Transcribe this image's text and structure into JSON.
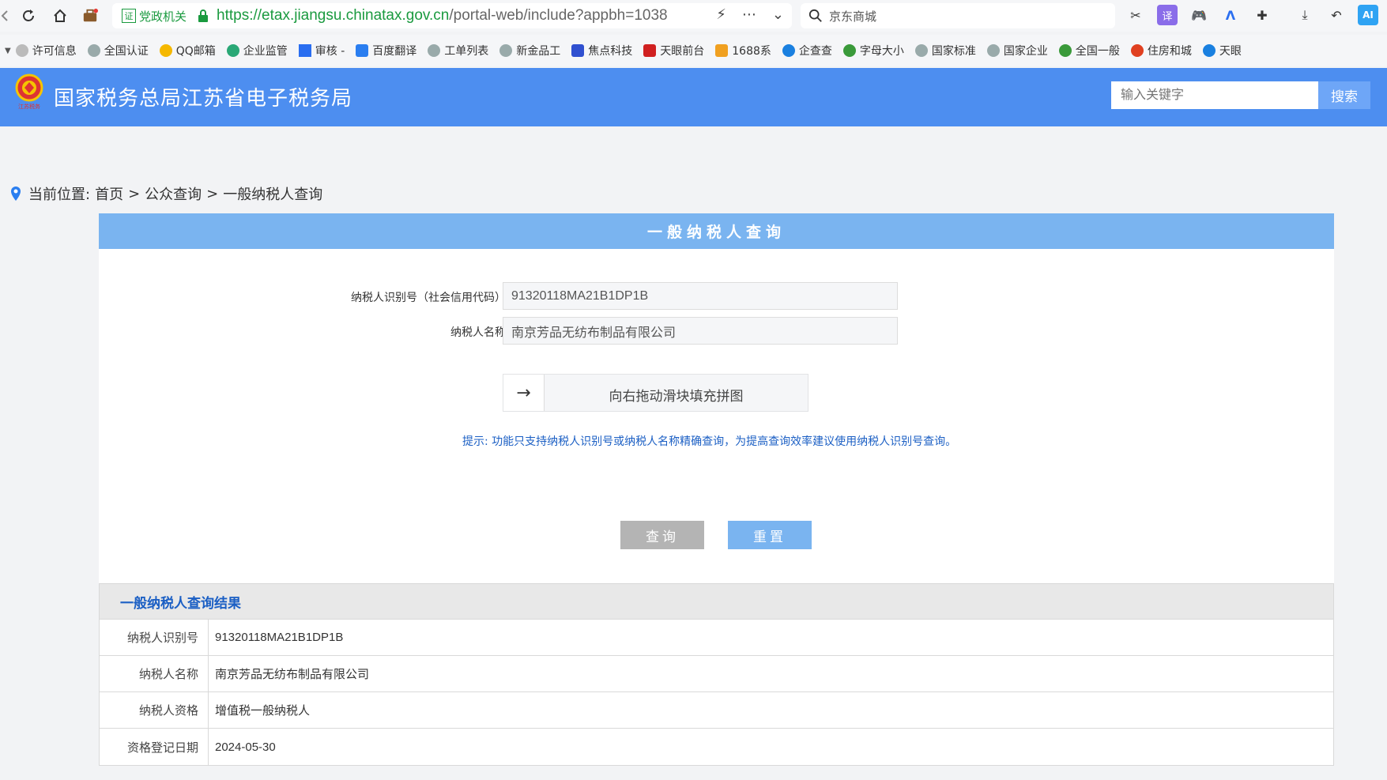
{
  "browser": {
    "gov_badge": "党政机关",
    "gov_badge_icon": "证",
    "url_host": "https://etax.jiangsu.chinatax.gov.cn",
    "url_path": "/portal-web/include?appbh=1038",
    "search_text": "京东商城",
    "bookmarks": [
      "许可信息",
      "全国认证",
      "QQ邮箱",
      "企业监管",
      "审核 -",
      "百度翻译",
      "工单列表",
      "新金品工",
      "焦点科技",
      "天眼前台",
      "1688系",
      "企查查",
      "字母大小",
      "国家标准",
      "国家企业",
      "全国一般",
      "住房和城",
      "天眼"
    ]
  },
  "site": {
    "title": "国家税务总局江苏省电子税务局",
    "emblem_caption": "江苏税务",
    "search_placeholder": "输入关键字",
    "search_button": "搜索"
  },
  "breadcrumb": {
    "label": "当前位置:",
    "home": "首页",
    "sep": ">",
    "section": "公众查询",
    "current": "一般纳税人查询"
  },
  "form": {
    "heading": "一般纳税人查询",
    "id_label": "纳税人识别号（社会信用代码）",
    "id_value": "91320118MA21B1DP1B",
    "name_label": "纳税人名称",
    "name_value": "南京芳品无纺布制品有限公司",
    "slider_text": "向右拖动滑块填充拼图",
    "tip": "提示:   功能只支持纳税人识别号或纳税人名称精确查询，为提高查询效率建议使用纳税人识别号查询。",
    "query_button": "查询",
    "reset_button": "重置"
  },
  "result": {
    "heading": "一般纳税人查询结果",
    "rows": [
      {
        "label": "纳税人识别号",
        "value": "91320118MA21B1DP1B"
      },
      {
        "label": "纳税人名称",
        "value": "南京芳品无纺布制品有限公司"
      },
      {
        "label": "纳税人资格",
        "value": "增值税一般纳税人"
      },
      {
        "label": "资格登记日期",
        "value": "2024-05-30"
      }
    ]
  },
  "colors": {
    "header_blue": "#4d8ef0",
    "panel_head": "#7ab4f0",
    "tip_blue": "#1b5fc4"
  }
}
